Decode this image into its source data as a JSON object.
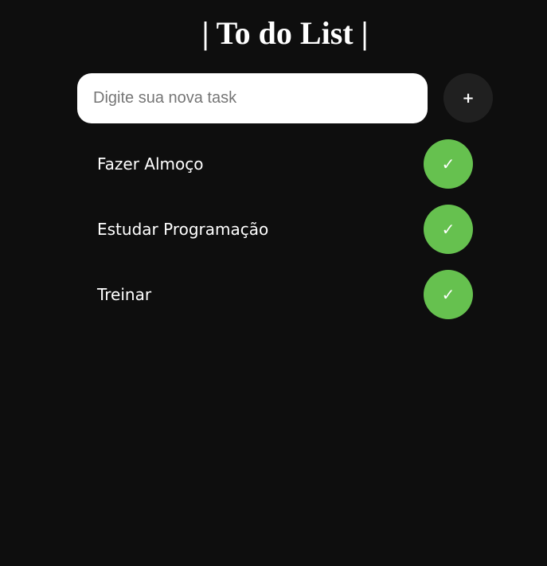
{
  "header": {
    "title": "| To do List |"
  },
  "new_task": {
    "placeholder": "Digite sua nova task",
    "value": "",
    "add_label": "+"
  },
  "tasks": [
    {
      "label": "Fazer Almoço",
      "done_icon": "✓"
    },
    {
      "label": "Estudar Programação",
      "done_icon": "✓"
    },
    {
      "label": "Treinar",
      "done_icon": "✓"
    }
  ],
  "colors": {
    "background": "#0e0e0e",
    "input_background": "#ffffff",
    "add_button": "#202020",
    "done_button": "#66c14f",
    "text": "#ffffff"
  },
  "icons": {
    "add": "plus-icon",
    "done": "check-icon"
  }
}
